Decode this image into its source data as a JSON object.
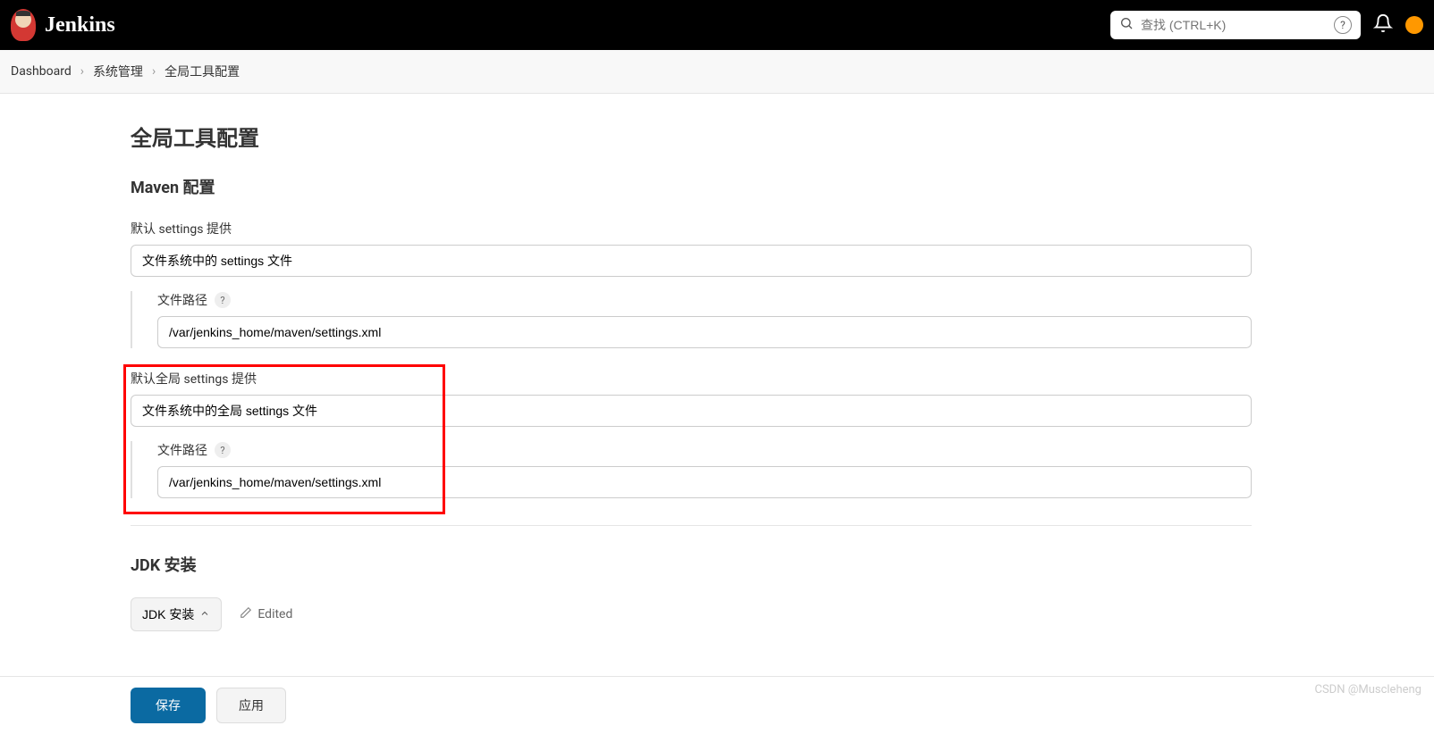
{
  "header": {
    "brand": "Jenkins",
    "search_placeholder": "查找 (CTRL+K)"
  },
  "breadcrumb": {
    "items": [
      "Dashboard",
      "系统管理",
      "全局工具配置"
    ]
  },
  "page": {
    "title": "全局工具配置"
  },
  "maven": {
    "section_title": "Maven 配置",
    "default_settings": {
      "label": "默认 settings 提供",
      "value": "文件系统中的 settings 文件",
      "path_label": "文件路径",
      "path_value": "/var/jenkins_home/maven/settings.xml"
    },
    "global_settings": {
      "label": "默认全局 settings 提供",
      "value": "文件系统中的全局 settings 文件",
      "path_label": "文件路径",
      "path_value": "/var/jenkins_home/maven/settings.xml"
    }
  },
  "jdk": {
    "section_title": "JDK 安装",
    "expand_label": "JDK 安装",
    "edited_label": "Edited"
  },
  "footer": {
    "save": "保存",
    "apply": "应用"
  },
  "watermark": "CSDN @Muscleheng"
}
